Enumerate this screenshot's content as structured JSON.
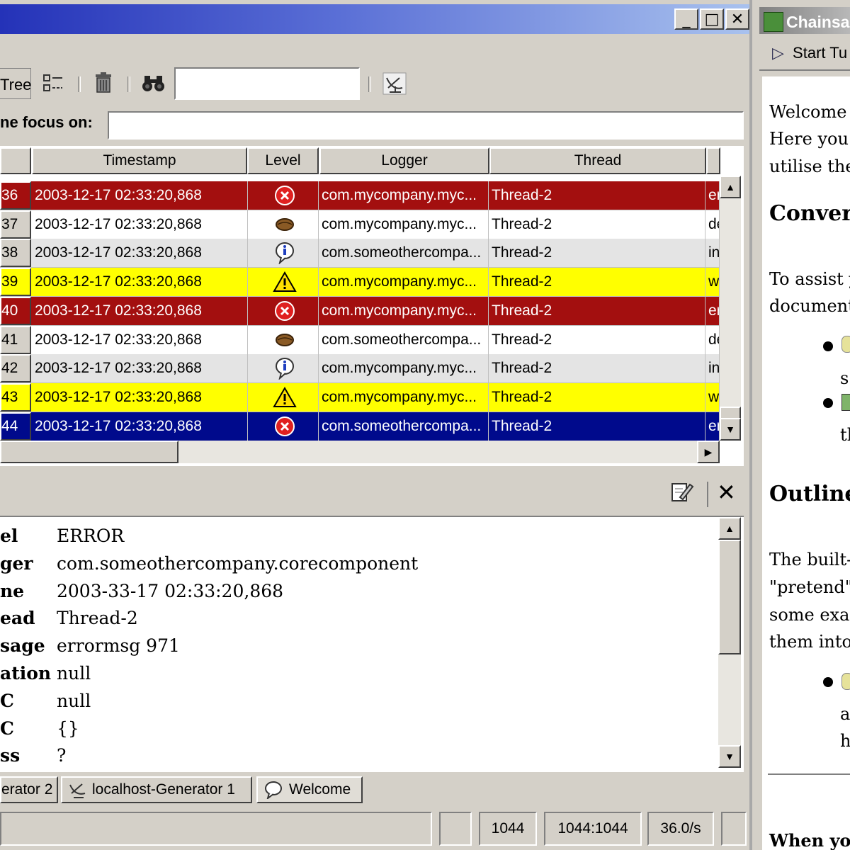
{
  "window": {
    "controls": {
      "minimize": "_",
      "maximize": "□",
      "close": "✕"
    }
  },
  "toolbar": {
    "tree_label": "Tree",
    "search_value": ""
  },
  "focus": {
    "label": "ne focus on:",
    "value": ""
  },
  "table": {
    "columns": [
      "Timestamp",
      "Level",
      "Logger",
      "Thread"
    ],
    "rows": [
      {
        "id": "36",
        "timestamp": "2003-12-17 02:33:20,868",
        "level": "error",
        "logger": "com.mycompany.myc...",
        "thread": "Thread-2",
        "msg": "er",
        "style": "error"
      },
      {
        "id": "37",
        "timestamp": "2003-12-17 02:33:20,868",
        "level": "debug",
        "logger": "com.mycompany.myc...",
        "thread": "Thread-2",
        "msg": "de",
        "style": "debug"
      },
      {
        "id": "38",
        "timestamp": "2003-12-17 02:33:20,868",
        "level": "info",
        "logger": "com.someothercompa...",
        "thread": "Thread-2",
        "msg": "in",
        "style": "info"
      },
      {
        "id": "39",
        "timestamp": "2003-12-17 02:33:20,868",
        "level": "warn",
        "logger": "com.mycompany.myc...",
        "thread": "Thread-2",
        "msg": "w",
        "style": "warn"
      },
      {
        "id": "40",
        "timestamp": "2003-12-17 02:33:20,868",
        "level": "error",
        "logger": "com.mycompany.myc...",
        "thread": "Thread-2",
        "msg": "er",
        "style": "error"
      },
      {
        "id": "41",
        "timestamp": "2003-12-17 02:33:20,868",
        "level": "debug",
        "logger": "com.someothercompa...",
        "thread": "Thread-2",
        "msg": "de",
        "style": "debug"
      },
      {
        "id": "42",
        "timestamp": "2003-12-17 02:33:20,868",
        "level": "info",
        "logger": "com.mycompany.myc...",
        "thread": "Thread-2",
        "msg": "in",
        "style": "info"
      },
      {
        "id": "43",
        "timestamp": "2003-12-17 02:33:20,868",
        "level": "warn",
        "logger": "com.mycompany.myc...",
        "thread": "Thread-2",
        "msg": "w",
        "style": "warn"
      },
      {
        "id": "44",
        "timestamp": "2003-12-17 02:33:20,868",
        "level": "error",
        "logger": "com.someothercompa...",
        "thread": "Thread-2",
        "msg": "er",
        "style": "selected"
      }
    ]
  },
  "colors": {
    "error_bg": "#a30f0f",
    "warn_bg": "#ffff00",
    "info_bg": "#e4e4e4",
    "debug_bg": "#ffffff",
    "selected_bg": "#000a8c"
  },
  "detail": {
    "fields": [
      {
        "key": "el",
        "value": "ERROR"
      },
      {
        "key": "ger",
        "value": "com.someothercompany.corecomponent"
      },
      {
        "key": "ne",
        "value": "2003-33-17 02:33:20,868"
      },
      {
        "key": "ead",
        "value": "Thread-2"
      },
      {
        "key": "sage",
        "value": "errormsg 971"
      },
      {
        "key": "ation",
        "value": "null"
      },
      {
        "key": "C",
        "value": "null"
      },
      {
        "key": "C",
        "value": "{}"
      },
      {
        "key": "ss",
        "value": "?"
      }
    ]
  },
  "tabs": [
    {
      "label": "erator 2"
    },
    {
      "label": "localhost-Generator 1"
    },
    {
      "label": "Welcome"
    }
  ],
  "status": {
    "count": "1044",
    "ratio": "1044:1044",
    "rate": "36.0/s"
  },
  "right_panel": {
    "title": "Chainsa",
    "start_label": "Start Tu",
    "lines": [
      {
        "text": "Welcome",
        "kind": "text"
      },
      {
        "text": "Here you v",
        "kind": "text"
      },
      {
        "text": "utilise the",
        "kind": "text"
      },
      {
        "text": "Conver",
        "kind": "heading"
      },
      {
        "text": "To assist y",
        "kind": "text"
      },
      {
        "text": "documenta",
        "kind": "text"
      },
      {
        "text": "s",
        "kind": "text"
      },
      {
        "text": "th",
        "kind": "text"
      },
      {
        "text": "Outline",
        "kind": "heading"
      },
      {
        "text": "The built-i",
        "kind": "text"
      },
      {
        "text": "\"pretend\" l",
        "kind": "text"
      },
      {
        "text": "some exan",
        "kind": "text"
      },
      {
        "text": "them into",
        "kind": "text"
      },
      {
        "text": "a",
        "kind": "text"
      },
      {
        "text": "h",
        "kind": "text"
      },
      {
        "text": "When yo",
        "kind": "text"
      }
    ]
  }
}
